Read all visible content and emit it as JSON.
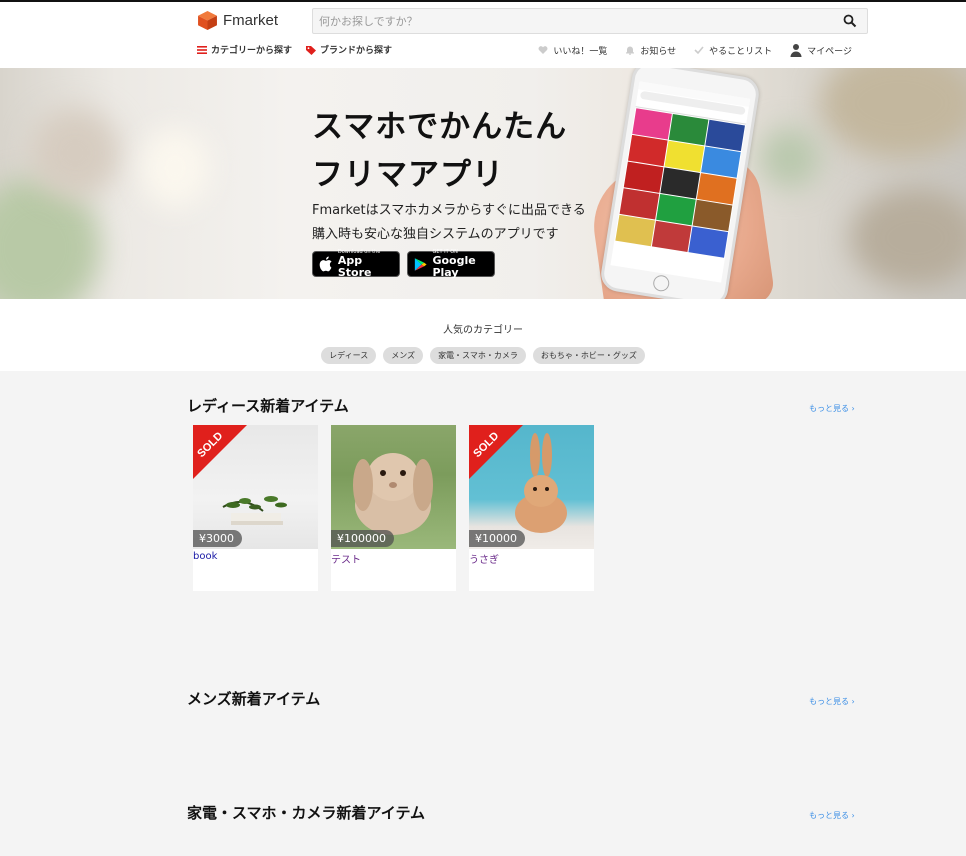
{
  "header": {
    "logo_text": "Fmarket",
    "search_placeholder": "何かお探しですか？",
    "nav_left": [
      {
        "label": "カテゴリーから探す",
        "icon": "list-icon"
      },
      {
        "label": "ブランドから探す",
        "icon": "tag-icon"
      }
    ],
    "nav_right": [
      {
        "label": "いいね！一覧",
        "icon": "heart-icon"
      },
      {
        "label": "お知らせ",
        "icon": "bell-icon"
      },
      {
        "label": "やることリスト",
        "icon": "check-icon"
      },
      {
        "label": "マイページ",
        "icon": "user-icon"
      }
    ]
  },
  "banner": {
    "headline_1": "スマホでかんたん",
    "headline_2": "フリマアプリ",
    "desc_1": "Fmarketはスマホカメラからすぐに出品できる",
    "desc_2": "購入時も安心な独自システムのアプリです",
    "appstore_small": "Download on the",
    "appstore_big": "App Store",
    "gplay_small": "GET IT ON",
    "gplay_big": "Google Play"
  },
  "popular": {
    "title": "人気のカテゴリー",
    "chips": [
      "レディース",
      "メンズ",
      "家電・スマホ・カメラ",
      "おもちゃ・ホビー・グッズ"
    ]
  },
  "sections": [
    {
      "title": "レディース新着アイテム",
      "more": "もっと見る ›",
      "items": [
        {
          "price": "¥3000",
          "name": "book",
          "sold": true,
          "sold_label": "SOLD"
        },
        {
          "price": "¥100000",
          "name": "テスト",
          "sold": false
        },
        {
          "price": "¥10000",
          "name": "うさぎ",
          "sold": true,
          "sold_label": "SOLD"
        }
      ]
    },
    {
      "title": "メンズ新着アイテム",
      "more": "もっと見る ›"
    },
    {
      "title": "家電・スマホ・カメラ新着アイテム",
      "more": "もっと見る ›"
    }
  ],
  "colors": {
    "accent": "#e0201c",
    "link": "#3a8ee6",
    "logo": "#e8512a"
  }
}
